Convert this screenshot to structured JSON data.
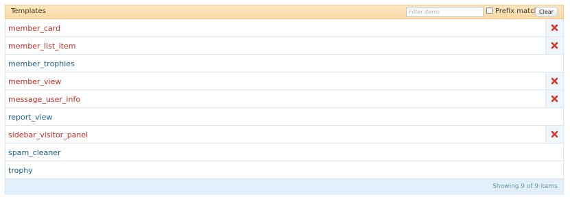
{
  "header": {
    "title": "Templates",
    "filter_placeholder": "Filter items",
    "filter_value": "",
    "prefix_match_label": "Prefix match",
    "prefix_match_checked": false,
    "clear_label": "Clear"
  },
  "rows": [
    {
      "name": "member_card",
      "state": "modified",
      "deletable": true
    },
    {
      "name": "member_list_item",
      "state": "modified",
      "deletable": true
    },
    {
      "name": "member_trophies",
      "state": "default",
      "deletable": false
    },
    {
      "name": "member_view",
      "state": "modified",
      "deletable": true
    },
    {
      "name": "message_user_info",
      "state": "modified",
      "deletable": true
    },
    {
      "name": "report_view",
      "state": "default",
      "deletable": false
    },
    {
      "name": "sidebar_visitor_panel",
      "state": "modified",
      "deletable": true
    },
    {
      "name": "spam_cleaner",
      "state": "default",
      "deletable": false
    },
    {
      "name": "trophy",
      "state": "default",
      "deletable": false
    }
  ],
  "footer": {
    "status": "Showing 9 of 9 items"
  },
  "icons": {
    "delete": "delete-x-icon"
  },
  "colors": {
    "modified_link": "#c8271c",
    "default_link": "#1e5d86",
    "header_bg": "#f8d9a6",
    "footer_bg": "#e1f0fb"
  }
}
